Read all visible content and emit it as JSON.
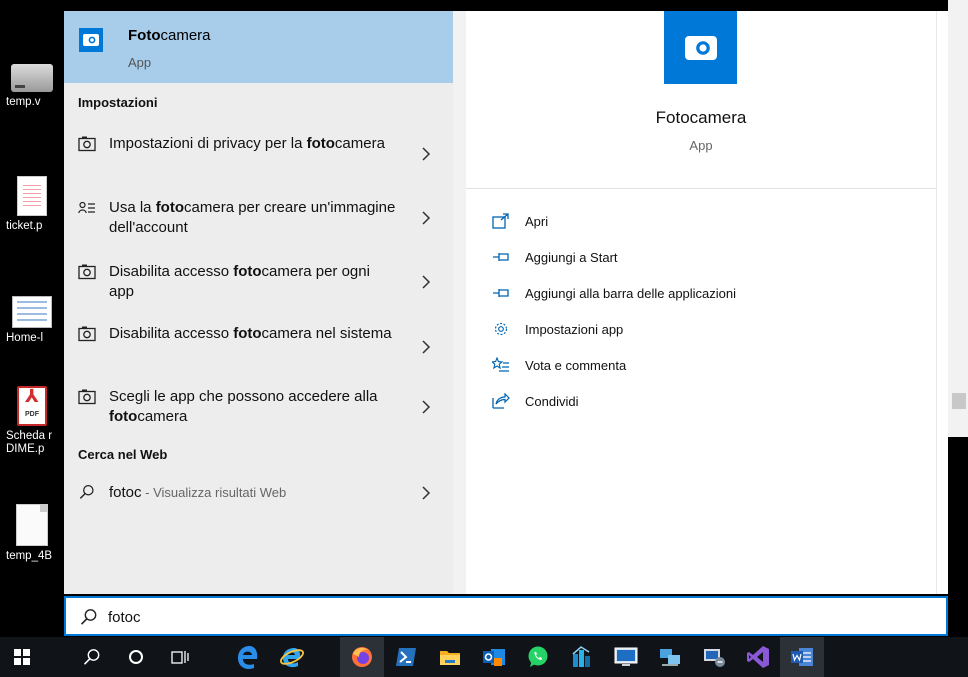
{
  "desktop": {
    "icons": [
      {
        "label": "temp.v"
      },
      {
        "label": "ticket.p"
      },
      {
        "label": "Home-l"
      },
      {
        "label": "Scheda r DIME.p"
      },
      {
        "label": "temp_4B"
      }
    ]
  },
  "best_match": {
    "name_bold": "Foto",
    "name_rest": "camera",
    "type": "App"
  },
  "settings_section": {
    "title": "Impostazioni",
    "items": [
      {
        "pre": "Impostazioni di privacy per la ",
        "bold": "foto",
        "post": "camera"
      },
      {
        "pre": "Usa la ",
        "bold": "foto",
        "post": "camera per creare un'immagine dell'account"
      },
      {
        "pre": "Disabilita accesso ",
        "bold": "foto",
        "post": "camera per ogni app"
      },
      {
        "pre": "Disabilita accesso ",
        "bold": "foto",
        "post": "camera nel sistema"
      },
      {
        "pre": "Scegli le app che possono accedere alla ",
        "bold": "foto",
        "post": "camera"
      }
    ]
  },
  "web_section": {
    "title": "Cerca nel Web",
    "query": "fotoc",
    "suffix": " - Visualizza risultati Web"
  },
  "preview": {
    "title": "Fotocamera",
    "subtitle": "App",
    "actions": [
      {
        "label": "Apri",
        "icon": "open-icon"
      },
      {
        "label": "Aggiungi a Start",
        "icon": "pin-icon"
      },
      {
        "label": "Aggiungi alla barra delle applicazioni",
        "icon": "pin-icon"
      },
      {
        "label": "Impostazioni app",
        "icon": "gear-icon"
      },
      {
        "label": "Vota e commenta",
        "icon": "star-list-icon"
      },
      {
        "label": "Condividi",
        "icon": "share-icon"
      }
    ]
  },
  "search": {
    "value": "fotoc"
  },
  "colors": {
    "accent": "#0078d7",
    "selected": "#a8cdeb",
    "taskbar": "#101418"
  }
}
